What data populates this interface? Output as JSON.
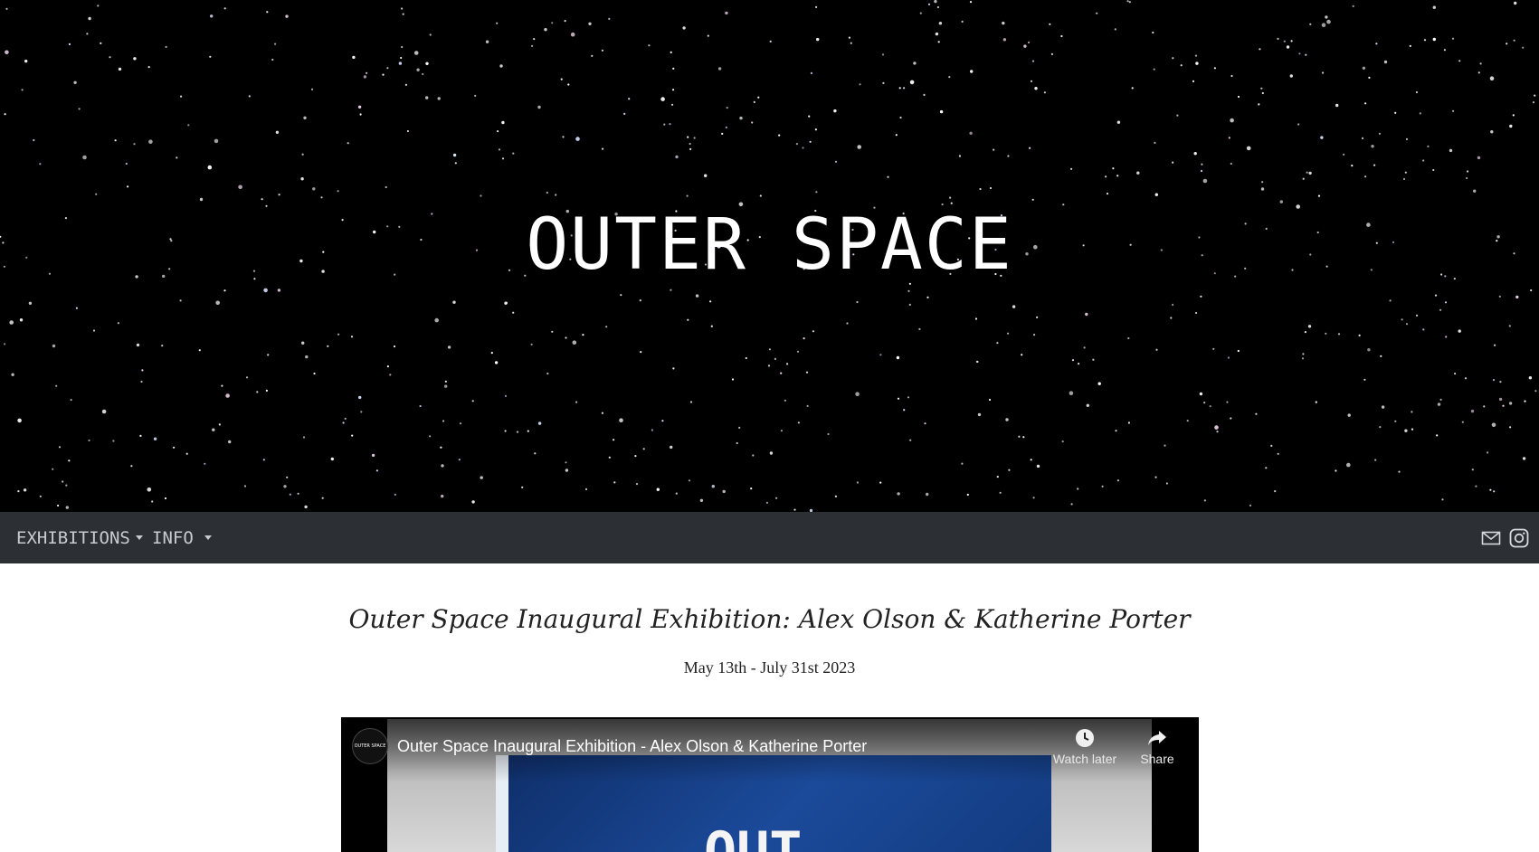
{
  "hero": {
    "title": "OUTER SPACE"
  },
  "nav": {
    "items": [
      {
        "label": "EXHIBITIONS",
        "icon": "caret-down-icon"
      },
      {
        "label": "INFO",
        "icon": "caret-down-icon"
      }
    ],
    "icons": [
      "mail-icon",
      "instagram-icon"
    ]
  },
  "exhibition": {
    "title": "Outer Space Inaugural Exhibition: Alex Olson & Katherine Porter",
    "dates": "May 13th - July 31st 2023"
  },
  "video": {
    "channel_logo": "OUTER SPACE",
    "title": "Outer Space Inaugural Exhibition - Alex Olson & Katherine Porter",
    "watch_later_label": "Watch later",
    "share_label": "Share",
    "thumbnail_text": "OUT"
  },
  "colors": {
    "navbar": "#2c3035",
    "nav_text": "#c8ccd0",
    "hero_bg": "#000000"
  }
}
